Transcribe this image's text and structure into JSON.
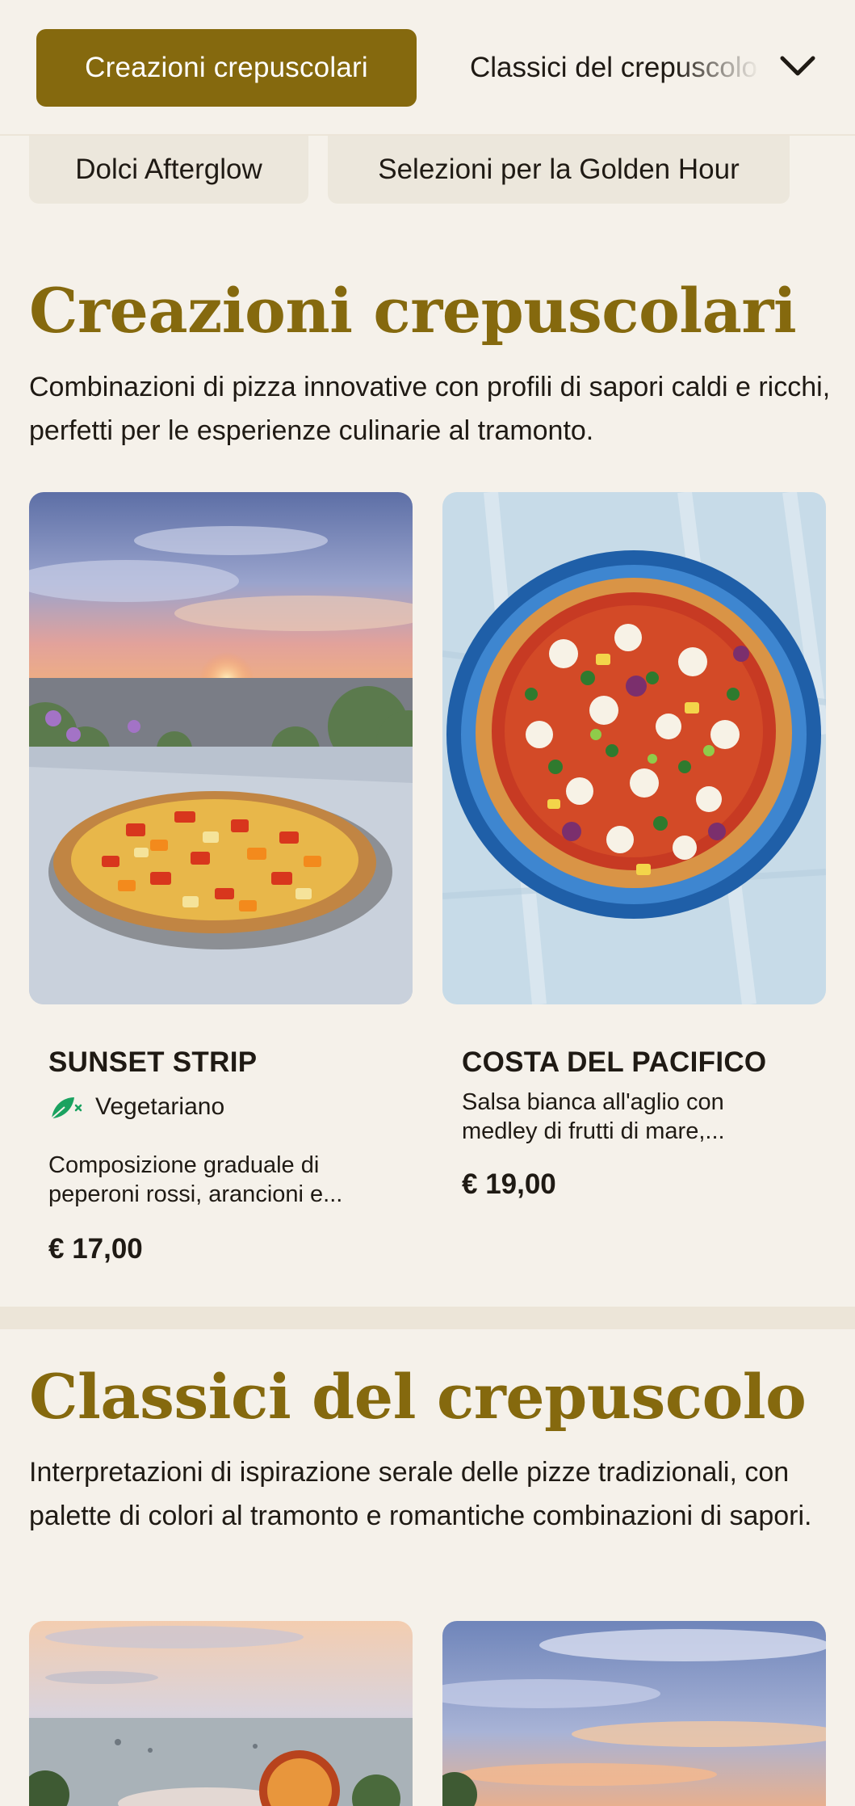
{
  "nav": {
    "active_category": "Creazioni crepuscolari",
    "next_category": "Classici del crepuscolo",
    "chevron_icon": "chevron-down-icon",
    "row2": [
      "Dolci Afterglow",
      "Selezioni per la Golden Hour"
    ]
  },
  "colors": {
    "accent": "#85690e",
    "background": "#f5f1ea",
    "veg_green": "#1aa260"
  },
  "sections": [
    {
      "title": "Creazioni crepuscolari",
      "description": "Combinazioni di pizza innovative con profili di sapori caldi e ricchi, perfetti per le esperienze culinarie al tramonto.",
      "items": [
        {
          "name": "SUNSET STRIP",
          "tag": "Vegetariano",
          "tag_icon": "leaf-vegetarian-icon",
          "description": "Composizione graduale di peperoni rossi, arancioni e...",
          "price": "€ 17,00"
        },
        {
          "name": "COSTA DEL PACIFICO",
          "description": "Salsa bianca all'aglio con medley di frutti di mare,...",
          "price": "€ 19,00"
        }
      ]
    },
    {
      "title": "Classici del crepuscolo",
      "description": "Interpretazioni di ispirazione serale delle pizze tradizionali, con palette di colori al tramonto e romantiche combinazioni di sapori."
    }
  ]
}
